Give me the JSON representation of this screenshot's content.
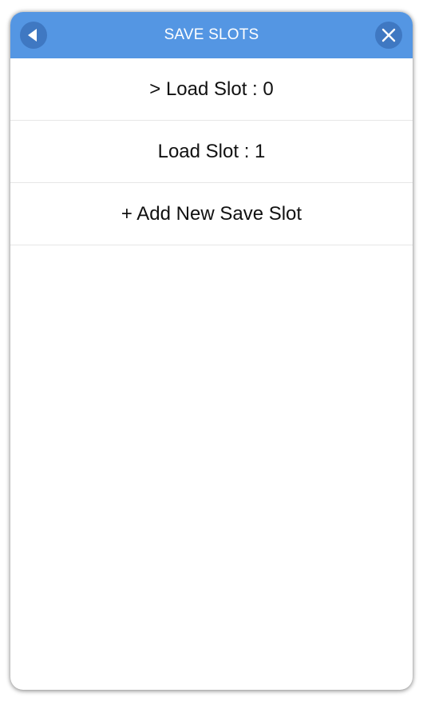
{
  "header": {
    "title": "SAVE SLOTS",
    "back_icon": "back-triangle-icon",
    "close_icon": "close-x-icon"
  },
  "slots": [
    {
      "label": "> Load Slot : 0"
    },
    {
      "label": "Load Slot : 1"
    },
    {
      "label": "+ Add New Save Slot"
    }
  ],
  "colors": {
    "header_bg": "#5496e3",
    "header_button_bg": "#3f78c2",
    "header_text": "#ffffff",
    "item_text": "#111111",
    "divider": "#e6e6e6"
  }
}
